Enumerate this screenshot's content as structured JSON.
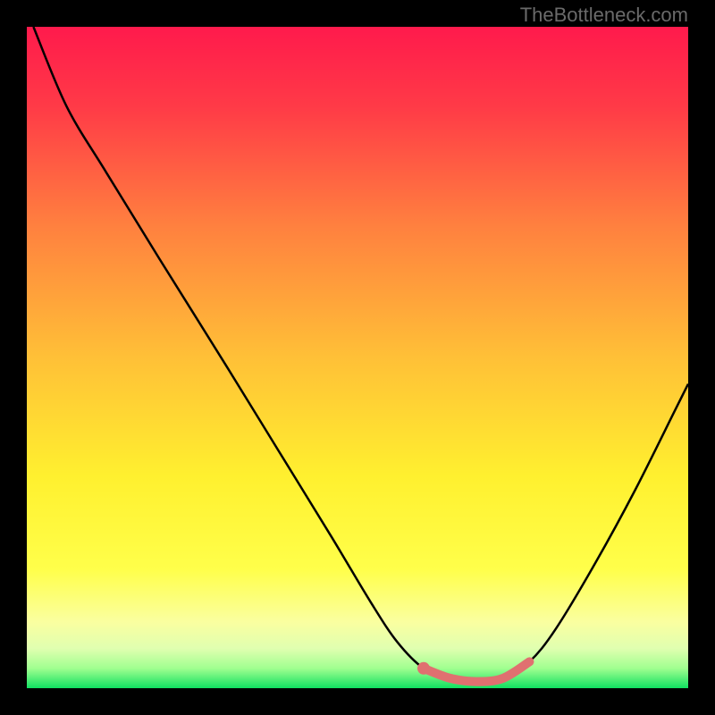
{
  "attribution": "TheBottleneck.com",
  "chart_data": {
    "type": "line",
    "title": "",
    "xlabel": "",
    "ylabel": "",
    "xlim": [
      0,
      100
    ],
    "ylim": [
      0,
      100
    ],
    "gradient_stops": [
      {
        "offset": 0,
        "color": "#ff1a4c"
      },
      {
        "offset": 0.12,
        "color": "#ff3a47"
      },
      {
        "offset": 0.3,
        "color": "#ff803f"
      },
      {
        "offset": 0.5,
        "color": "#ffc037"
      },
      {
        "offset": 0.68,
        "color": "#fff02f"
      },
      {
        "offset": 0.82,
        "color": "#ffff4a"
      },
      {
        "offset": 0.9,
        "color": "#faffa0"
      },
      {
        "offset": 0.94,
        "color": "#e0ffb0"
      },
      {
        "offset": 0.97,
        "color": "#a0ff90"
      },
      {
        "offset": 1.0,
        "color": "#10e060"
      }
    ],
    "series": [
      {
        "name": "bottleneck-curve",
        "color": "#000000",
        "points": [
          {
            "x": 1,
            "y": 100
          },
          {
            "x": 6,
            "y": 88
          },
          {
            "x": 12,
            "y": 78
          },
          {
            "x": 20,
            "y": 65
          },
          {
            "x": 30,
            "y": 49
          },
          {
            "x": 38,
            "y": 36
          },
          {
            "x": 46,
            "y": 23
          },
          {
            "x": 52,
            "y": 13
          },
          {
            "x": 56,
            "y": 7
          },
          {
            "x": 60,
            "y": 3
          },
          {
            "x": 64,
            "y": 1.5
          },
          {
            "x": 68,
            "y": 1
          },
          {
            "x": 72,
            "y": 1.5
          },
          {
            "x": 76,
            "y": 4
          },
          {
            "x": 80,
            "y": 9
          },
          {
            "x": 86,
            "y": 19
          },
          {
            "x": 92,
            "y": 30
          },
          {
            "x": 98,
            "y": 42
          },
          {
            "x": 100,
            "y": 46
          }
        ]
      },
      {
        "name": "optimal-highlight",
        "color": "#e07070",
        "points": [
          {
            "x": 60,
            "y": 3
          },
          {
            "x": 64,
            "y": 1.5
          },
          {
            "x": 68,
            "y": 1
          },
          {
            "x": 72,
            "y": 1.5
          },
          {
            "x": 76,
            "y": 4
          }
        ]
      }
    ],
    "highlight_marker": {
      "x": 60,
      "y": 3,
      "color": "#e07070"
    }
  }
}
